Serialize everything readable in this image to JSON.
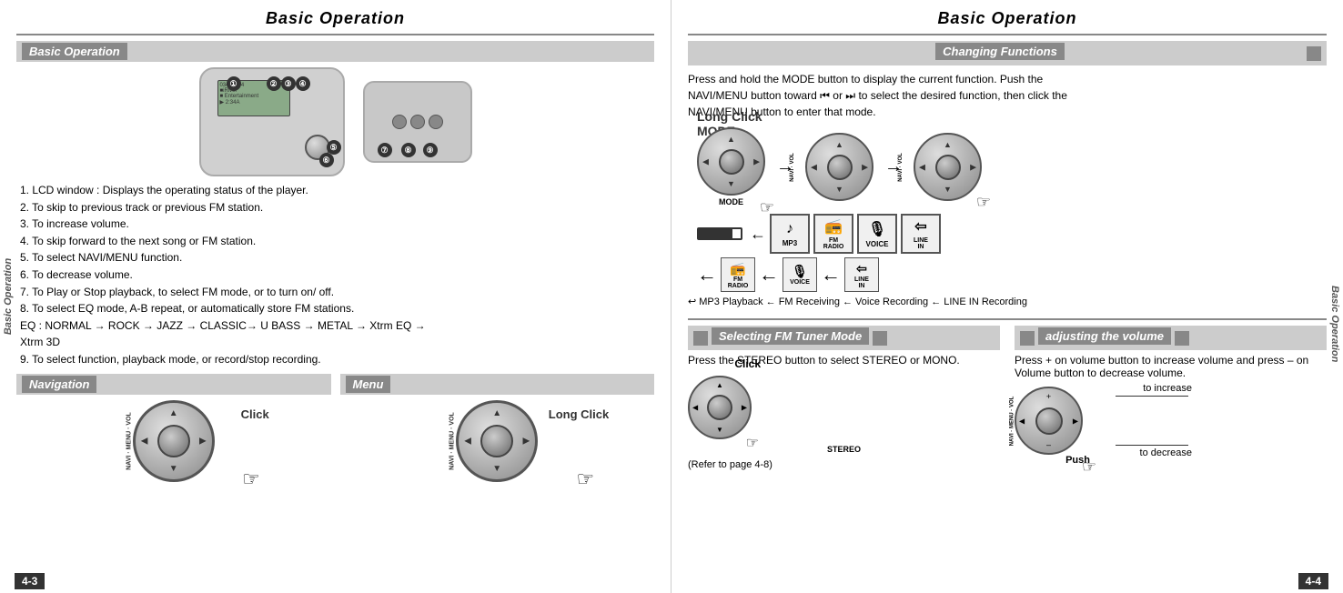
{
  "left_page": {
    "title": "Basic Operation",
    "page_number": "4-3",
    "section_basic": {
      "label": "Basic Operation"
    },
    "callouts": [
      "①",
      "②",
      "③",
      "④",
      "⑤",
      "⑥",
      "⑦",
      "⑧",
      "⑨"
    ],
    "features": [
      "1. LCD window : Displays the operating status of the player.",
      "2. To skip to previous track or previous FM station.",
      "3. To increase volume.",
      "4. To skip forward to the next song or FM station.",
      "5. To select NAVI/MENU function.",
      "6. To decrease volume.",
      "7. To Play or Stop playback, to select FM mode, or to turn on/ off.",
      "8. To select EQ mode, A-B repeat, or automatically store FM stations.",
      "   EQ : NORMAL → ROCK → JAZZ → CLASSIC→ U BASS → METAL → Xtrm EQ →",
      "        Xtrm 3D",
      "9. To select function, playback mode, or record/stop recording."
    ],
    "section_navigation": {
      "label": "Navigation"
    },
    "section_menu": {
      "label": "Menu"
    },
    "click_label": "Click",
    "long_click_label": "Long Click",
    "dial_labels": {
      "navi_menu_vol": "NAVI · VOL"
    }
  },
  "right_page": {
    "title": "Basic Operation",
    "page_number": "4-4",
    "section_changing": {
      "label": "Changing Functions"
    },
    "cf_text_1": "Press and hold the MODE button to display the current function. Push the",
    "cf_text_2": "NAVI/MENU button toward ⏮ or ⏭ to select the desired function, then click the",
    "cf_text_3": "NAVI/MENU button to enter that mode.",
    "long_click_mode_label": "Long Click MODE",
    "mode_label": "MODE",
    "function_icons": [
      {
        "symbol": "♪",
        "label": "MP3"
      },
      {
        "symbol": "📻",
        "label": "FM\nRADIO"
      },
      {
        "symbol": "🎙",
        "label": "VOICE"
      },
      {
        "symbol": "⇦",
        "label": "LINE\nIN"
      }
    ],
    "function_icons_small": [
      {
        "symbol": "📻",
        "label": "FM\nRADIO"
      },
      {
        "symbol": "🎙",
        "label": "VOICE"
      },
      {
        "symbol": "⇦",
        "label": "LINE\nIN"
      }
    ],
    "playback_text": "↩ MP3 Playback ← FM Receiving ← Voice Recording ← LINE IN Recording",
    "section_fm_tuner": {
      "label": "Selecting FM Tuner Mode"
    },
    "fm_text": "Press the STEREO button to select STEREO or MONO.",
    "stereo_label": "STEREO",
    "refer_text": "(Refer to page 4-8)",
    "click_label": "Click",
    "section_volume": {
      "label": "adjusting the volume"
    },
    "vol_text": "Press + on volume button to increase volume and press – on Volume button to decrease volume.",
    "to_increase": "to increase",
    "to_decrease": "to decrease",
    "push_label": "Push",
    "sidebar_label": "Basic Operation"
  }
}
